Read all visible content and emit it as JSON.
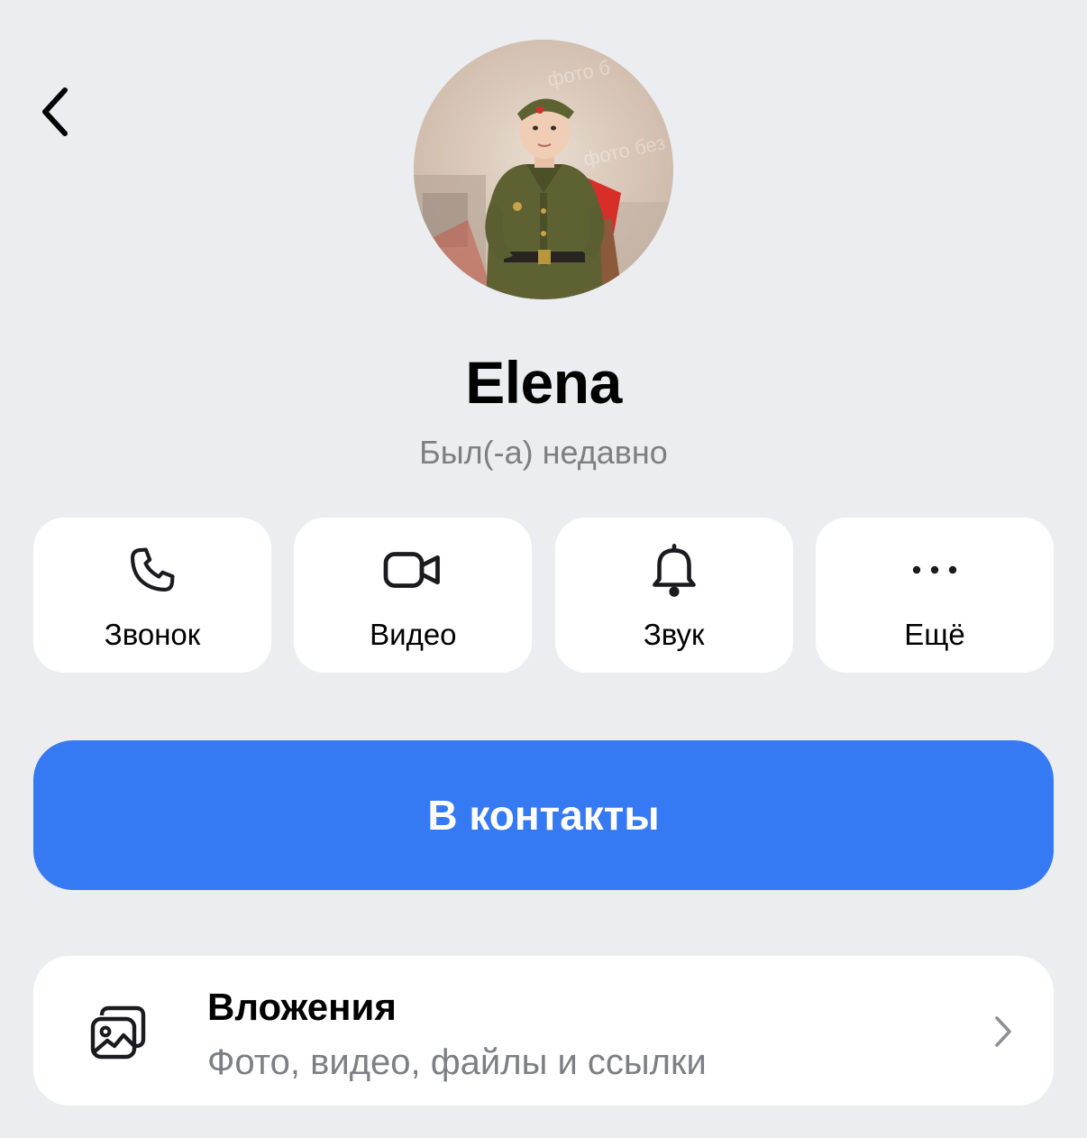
{
  "header": {
    "back_icon": "chevron-left-icon"
  },
  "profile": {
    "name": "Elena",
    "status": "Был(-а) недавно",
    "avatar": "profile-photo"
  },
  "actions": [
    {
      "label": "Звонок",
      "icon": "phone-icon"
    },
    {
      "label": "Видео",
      "icon": "video-camera-icon"
    },
    {
      "label": "Звук",
      "icon": "bell-icon"
    },
    {
      "label": "Ещё",
      "icon": "more-dots-icon"
    }
  ],
  "primary_button": {
    "label": "В контакты",
    "color": "#3579f3"
  },
  "attachments": {
    "title": "Вложения",
    "subtitle": "Фото, видео, файлы и ссылки",
    "icon": "media-gallery-icon",
    "chevron": "chevron-right-icon"
  },
  "colors": {
    "background": "#ebedf1",
    "card": "#ffffff",
    "secondary_text": "#7d7f84",
    "accent": "#3579f3"
  }
}
